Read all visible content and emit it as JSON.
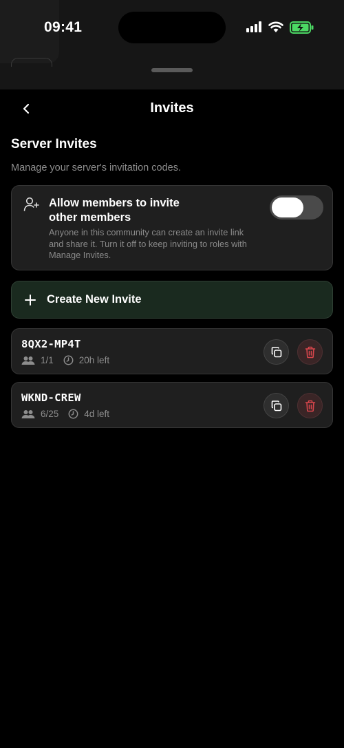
{
  "status_bar": {
    "time": "09:41"
  },
  "nav": {
    "title": "Invites",
    "back_icon": "chevron-left-icon"
  },
  "section": {
    "title": "Server Invites",
    "subtitle": "Manage your server's invitation codes."
  },
  "allow_setting": {
    "icon": "user-plus-icon",
    "title": "Allow members to invite other members",
    "description": "Anyone in this community can create an invite link and share it. Turn it off to keep inviting to roles with Manage Invites.",
    "enabled": true
  },
  "create_invite": {
    "icon": "plus-icon",
    "label": "Create New Invite"
  },
  "invites": [
    {
      "code": "8QX2-MP4T",
      "uses": "1/1",
      "expires": "20h left"
    },
    {
      "code": "WKND-CREW",
      "uses": "6/25",
      "expires": "4d left"
    }
  ],
  "colors": {
    "background": "#000000",
    "card": "#1f1f1f",
    "create_card": "#1a2a1f",
    "delete_icon": "#d9464c",
    "muted_text": "#8d8d8d",
    "battery_fill": "#4cd964"
  }
}
